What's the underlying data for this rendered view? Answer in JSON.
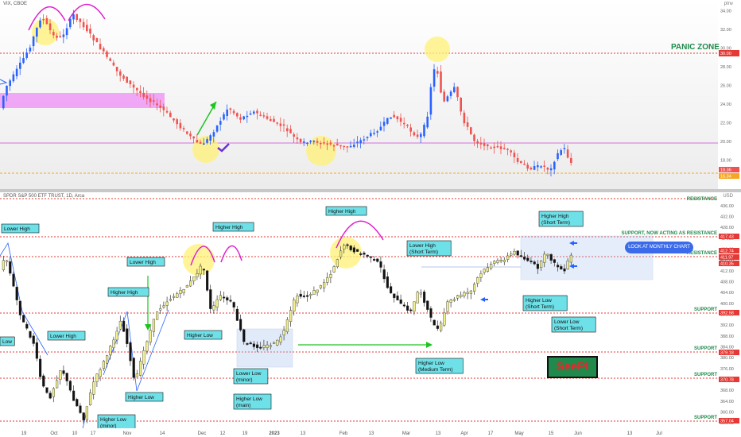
{
  "vix": {
    "title": "VIX, CBOE",
    "unit": "pInv",
    "panic_label": "PANIC ZONE",
    "ticks": [
      "34.00",
      "32.00",
      "30.00",
      "28.00",
      "26.00",
      "24.00",
      "22.00",
      "20.00",
      "18.00"
    ],
    "price_badges": [
      "18.36",
      "16.34"
    ],
    "colors": {
      "up": "#2962ff",
      "down": "#ef5350",
      "pink_zone": "#ee8cf5",
      "panic": "#1f8a4c"
    }
  },
  "spy": {
    "title": "SPDR S&P 500 ETF TRUST, 1D, Arca",
    "unit": "USD",
    "ticks": [
      "436.00",
      "432.00",
      "428.00",
      "424.00",
      "420.00",
      "416.00",
      "412.00",
      "408.00",
      "404.00",
      "400.00",
      "396.00",
      "392.00",
      "388.00",
      "384.00",
      "380.00",
      "376.00",
      "372.00",
      "368.00",
      "364.00",
      "360.00",
      "356.00"
    ],
    "price_badges": [
      "417.43",
      "412.74",
      "411.97",
      "410.35",
      "392.58",
      "379.18",
      "370.78",
      "357.04"
    ],
    "levels": [
      {
        "label": "RESISTANCE"
      },
      {
        "label": "SUPPORT, NOW ACTING AS RESISTANCE"
      },
      {
        "label": "RESISTANCE"
      },
      {
        "label": "SUPPORT"
      },
      {
        "label": "SUPPORT"
      },
      {
        "label": "SUPPORT"
      },
      {
        "label": "SUPPORT"
      }
    ],
    "annotations": [
      {
        "text": "Lower High",
        "sub": ""
      },
      {
        "text": "Lower High",
        "sub": ""
      },
      {
        "text": "Low",
        "sub": ""
      },
      {
        "text": "Higher Low",
        "sub": "(minor)"
      },
      {
        "text": "Higher High",
        "sub": ""
      },
      {
        "text": "Lower High",
        "sub": ""
      },
      {
        "text": "Higher Low",
        "sub": ""
      },
      {
        "text": "Higher High",
        "sub": ""
      },
      {
        "text": "Higher Low",
        "sub": ""
      },
      {
        "text": "Lower Low",
        "sub": "(minor)"
      },
      {
        "text": "Higher Low",
        "sub": "(main)"
      },
      {
        "text": "Higher High",
        "sub": ""
      },
      {
        "text": "Lower High",
        "sub": "(Short Term)"
      },
      {
        "text": "Higher Low",
        "sub": "(Medium Term)"
      },
      {
        "text": "Higher High",
        "sub": "(Short Term)"
      },
      {
        "text": "Higher Low",
        "sub": "(Short Term)"
      },
      {
        "text": "Lower Low",
        "sub": "(Short Term)"
      }
    ],
    "callout": "LOOK AT MONTHLY CHART",
    "signature": "SeePI"
  },
  "date_axis": [
    "19",
    "Oct",
    "10",
    "17",
    "Nov",
    "14",
    "Dec",
    "12",
    "19",
    "2023",
    "13",
    "Feb",
    "13",
    "Mar",
    "13",
    "Apr",
    "17",
    "May",
    "15",
    "Jun",
    "13",
    "Jul"
  ],
  "chart_data": [
    {
      "type": "line",
      "title": "VIX, CBOE",
      "ylabel": "",
      "ylim": [
        16,
        35
      ],
      "x": [
        "19",
        "Oct",
        "10",
        "17",
        "Nov",
        "14",
        "Dec",
        "12",
        "19",
        "2023",
        "13",
        "Feb",
        "13",
        "Mar",
        "13",
        "Apr",
        "17",
        "May"
      ],
      "series": [
        {
          "values": [
            24.5,
            31.5,
            30.5,
            32.5,
            25.0,
            23.0,
            20.5,
            23.5,
            21.5,
            19.5,
            19.0,
            18.5,
            19.5,
            26.0,
            21.0,
            18.5,
            17.0,
            17.5
          ]
        }
      ]
    },
    {
      "type": "line",
      "title": "SPDR S&P 500 ETF TRUST, 1D, Arca",
      "ylabel": "",
      "ylim": [
        356,
        438
      ],
      "x": [
        "19",
        "Oct",
        "10",
        "17",
        "Nov",
        "14",
        "Dec",
        "12",
        "19",
        "2023",
        "13",
        "Feb",
        "13",
        "Mar",
        "13",
        "Apr",
        "17",
        "May"
      ],
      "series": [
        {
          "values": [
            384,
            362,
            372,
            357,
            386,
            399,
            403,
            414,
            402,
            383,
            398,
            418,
            413,
            393,
            390,
            409,
            415,
            412
          ]
        }
      ]
    }
  ]
}
